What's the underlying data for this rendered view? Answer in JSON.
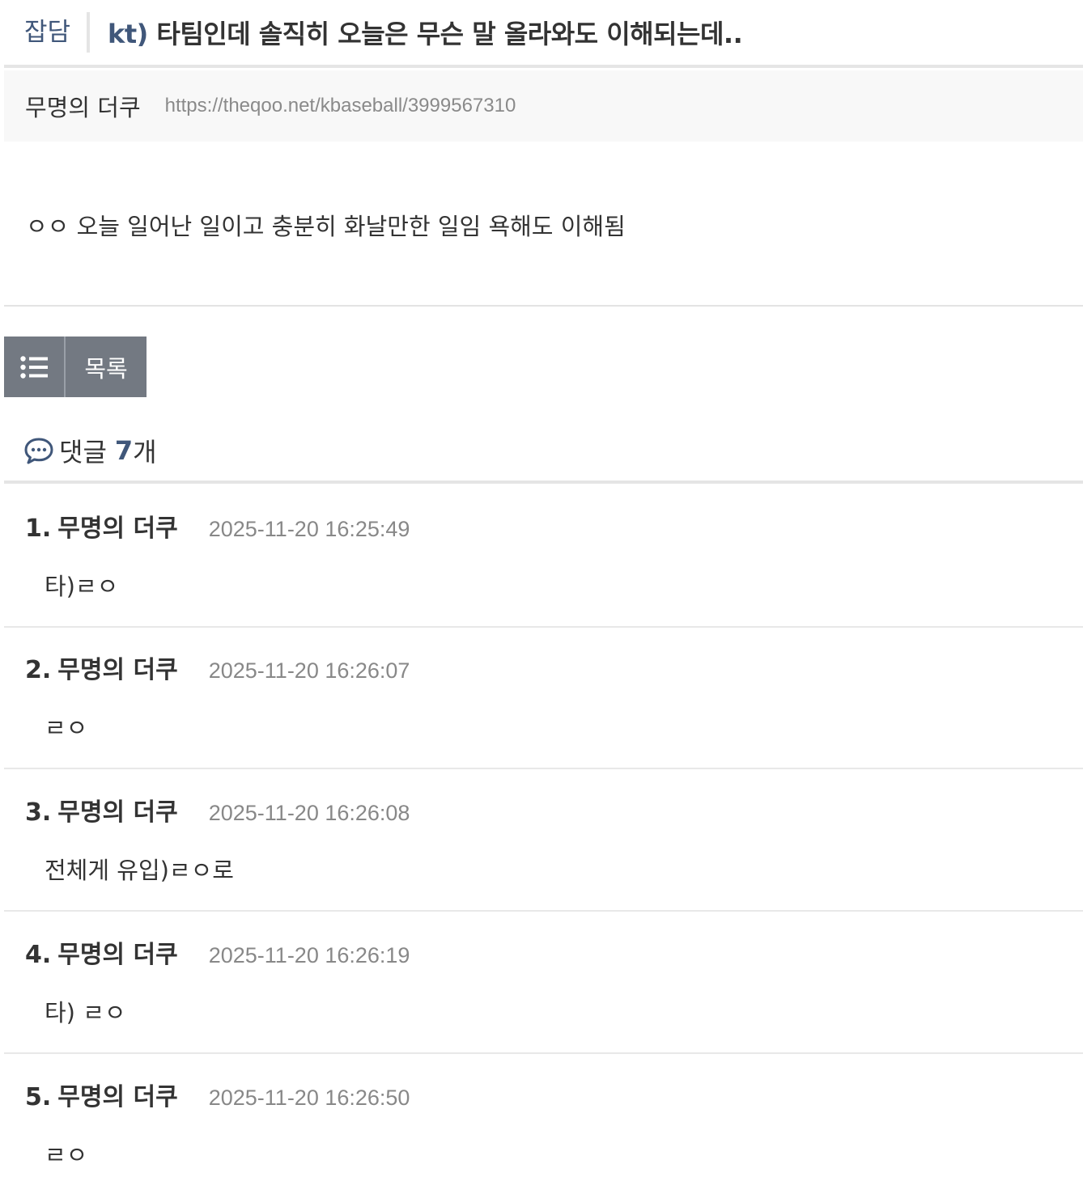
{
  "post": {
    "category": "잡담",
    "title_prefix": "kt)",
    "title_rest": " 타팀인데 솔직히 오늘은 무슨 말 올라와도 이해되는데..",
    "author": "무명의 더쿠",
    "url": "https://theqoo.net/kbaseball/3999567310",
    "body": "ㅇㅇ 오늘 일어난 일이고 충분히 화날만한 일임 욕해도  이해됨"
  },
  "list_button": {
    "icon": "list-icon",
    "label": "목록"
  },
  "comments_header": {
    "icon": "chat-bubble-icon",
    "label": "댓글",
    "count": "7",
    "unit": "개"
  },
  "comments": [
    {
      "num": "1.",
      "name": "무명의 더쿠",
      "date": "2025-11-20 16:25:49",
      "text": "타)ㄹㅇ"
    },
    {
      "num": "2.",
      "name": "무명의 더쿠",
      "date": "2025-11-20 16:26:07",
      "text": "ㄹㅇ"
    },
    {
      "num": "3.",
      "name": "무명의 더쿠",
      "date": "2025-11-20 16:26:08",
      "text": "전체게 유입)ㄹㅇ로"
    },
    {
      "num": "4.",
      "name": "무명의 더쿠",
      "date": "2025-11-20 16:26:19",
      "text": "타) ㄹㅇ"
    },
    {
      "num": "5.",
      "name": "무명의 더쿠",
      "date": "2025-11-20 16:26:50",
      "text": "ㄹㅇ"
    }
  ],
  "colors": {
    "accent": "#40577a",
    "button_bg": "#737982",
    "meta_gray": "#888888"
  }
}
